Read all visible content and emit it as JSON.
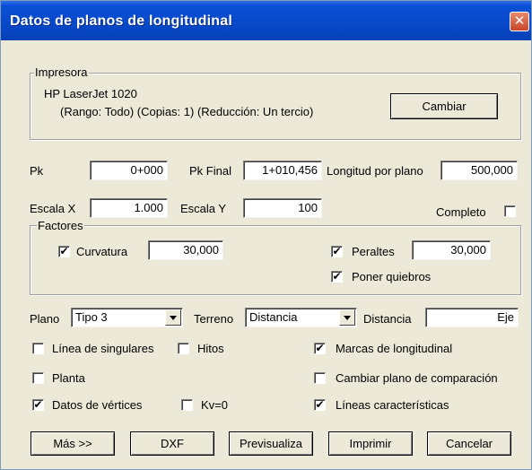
{
  "window": {
    "title": "Datos de planos de longitudinal",
    "close": "✕"
  },
  "printer": {
    "legend": "Impresora",
    "name": "HP LaserJet 1020",
    "details": "(Rango: Todo) (Copias: 1) (Reducción: Un tercio)",
    "change_label": "Cambiar"
  },
  "fields": {
    "pk_label": "Pk",
    "pk_value": "0+000",
    "pk_final_label": "Pk Final",
    "pk_final_value": "1+010,456",
    "longitud_label": "Longitud por plano",
    "longitud_value": "500,000",
    "escala_x_label": "Escala X",
    "escala_x_value": "1.000",
    "escala_y_label": "Escala Y",
    "escala_y_value": "100",
    "completo_label": "Completo"
  },
  "factores": {
    "legend": "Factores",
    "curvatura_label": "Curvatura",
    "curvatura_value": "30,000",
    "peraltes_label": "Peraltes",
    "peraltes_value": "30,000",
    "quiebros_label": "Poner quiebros"
  },
  "selectors": {
    "plano_label": "Plano",
    "plano_value": "Tipo 3",
    "terreno_label": "Terreno",
    "terreno_value": "Distancia",
    "distancia_label": "Distancia",
    "distancia_value": "Eje"
  },
  "options": {
    "singulares": "Línea de singulares",
    "hitos": "Hitos",
    "marcas": "Marcas de longitudinal",
    "planta": "Planta",
    "cambiar_plano": "Cambiar plano de comparación",
    "vertices": "Datos de vértices",
    "kv0": "Kv=0",
    "caracteristicas": "Líneas características"
  },
  "checks": {
    "mark": "✔"
  },
  "buttons": {
    "mas": "Más >>",
    "dxf": "DXF",
    "previsualiza": "Previsualiza",
    "imprimir": "Imprimir",
    "cancelar": "Cancelar"
  }
}
